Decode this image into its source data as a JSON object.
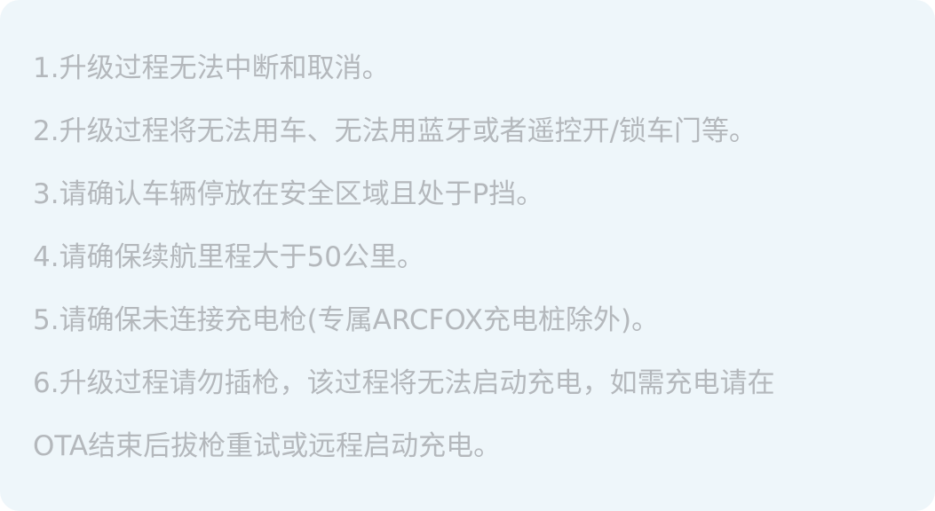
{
  "notice": {
    "lines": [
      "1.升级过程无法中断和取消。",
      "2.升级过程将无法用车、无法用蓝牙或者遥控开/锁车门等。",
      "3.请确认车辆停放在安全区域且处于P挡。",
      "4.请确保续航里程大于50公里。",
      "5.请确保未连接充电枪(专属ARCFOX充电桩除外)。",
      "6.升级过程请勿插枪，该过程将无法启动充电，如需充电请在",
      "OTA结束后拔枪重试或远程启动充电。"
    ]
  },
  "colors": {
    "card_background": "#eef6fa",
    "text": "#b4b8bc"
  }
}
